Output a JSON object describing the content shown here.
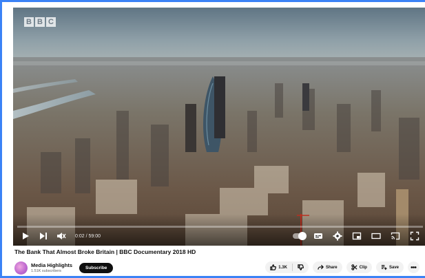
{
  "player": {
    "watermark": "BBC",
    "progress_fraction": 0.0,
    "time_display": "0:02 / 59:00"
  },
  "video": {
    "title": "The Bank That Almost Broke Britain | BBC Documentary 2018 HD"
  },
  "channel": {
    "name": "Media Highlights",
    "subscribers": "1.51K subscribers",
    "subscribe_label": "Subscribe"
  },
  "actions": {
    "like_count": "1.3K",
    "share_label": "Share",
    "clip_label": "Clip",
    "save_label": "Save"
  },
  "icons": {
    "play": "play-icon",
    "next": "next-icon",
    "volume": "volume-muted-icon",
    "autoplay": "autoplay-toggle",
    "subtitles": "subtitles-icon",
    "settings": "gear-icon",
    "miniplayer": "miniplayer-icon",
    "theater": "theater-icon",
    "cast": "cast-icon",
    "fullscreen": "fullscreen-icon",
    "like": "thumbs-up-icon",
    "dislike": "thumbs-down-icon",
    "share": "share-icon",
    "clip": "scissors-icon",
    "save": "save-playlist-icon"
  },
  "colors": {
    "progress": "#ff0000",
    "subscribe_bg": "#0f0f0f",
    "pill_bg": "#f2f2f2",
    "frame_border": "#3b82f6"
  }
}
